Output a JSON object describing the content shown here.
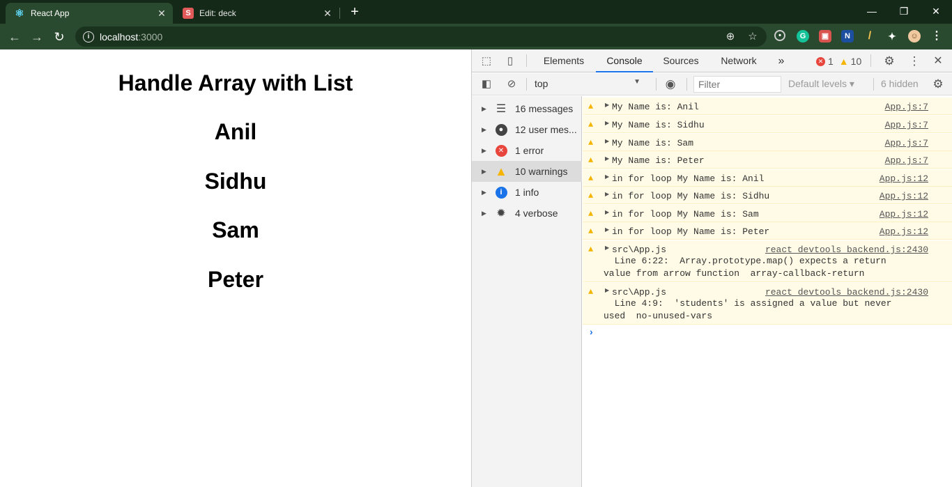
{
  "tabs": [
    {
      "title": "React App",
      "active": true,
      "favicon": "react-icon"
    },
    {
      "title": "Edit: deck",
      "active": false,
      "favicon": "s-icon"
    }
  ],
  "toolbar": {
    "url_host": "localhost",
    "url_port": ":3000"
  },
  "page": {
    "heading": "Handle Array with List",
    "names": [
      "Anil",
      "Sidhu",
      "Sam",
      "Peter"
    ]
  },
  "devtools": {
    "tabs": [
      "Elements",
      "Console",
      "Sources",
      "Network"
    ],
    "more": "»",
    "error_count": "1",
    "warning_count": "10",
    "context": "top",
    "filter_placeholder": "Filter",
    "levels": "Default levels ▾",
    "hidden": "6 hidden",
    "sidebar": [
      {
        "label": "16 messages",
        "icon": "list-icon"
      },
      {
        "label": "12 user mes...",
        "icon": "user-icon"
      },
      {
        "label": "1 error",
        "icon": "error-icon"
      },
      {
        "label": "10 warnings",
        "icon": "warning-icon",
        "selected": true
      },
      {
        "label": "1 info",
        "icon": "info-icon"
      },
      {
        "label": "4 verbose",
        "icon": "bug-icon"
      }
    ],
    "messages": [
      {
        "text": "My Name is: Anil",
        "source": "App.js:7"
      },
      {
        "text": "My Name is: Sidhu",
        "source": "App.js:7"
      },
      {
        "text": "My Name is: Sam",
        "source": "App.js:7"
      },
      {
        "text": "My Name is: Peter",
        "source": "App.js:7"
      },
      {
        "text": "in for loop My Name is: Anil",
        "source": "App.js:12"
      },
      {
        "text": "in for loop My Name is: Sidhu",
        "source": "App.js:12"
      },
      {
        "text": "in for loop My Name is: Sam",
        "source": "App.js:12"
      },
      {
        "text": "in for loop My Name is: Peter",
        "source": "App.js:12"
      }
    ],
    "lint_messages": [
      {
        "text": "src\\App.js",
        "source": "react_devtools_backend.js:2430",
        "line1": "  Line 6:22:  Array.prototype.map() expects a return",
        "line2": "value from arrow function  array-callback-return"
      },
      {
        "text": "src\\App.js",
        "source": "react_devtools_backend.js:2430",
        "line1": "  Line 4:9:  'students' is assigned a value but never",
        "line2": "used  no-unused-vars"
      }
    ],
    "prompt": "›"
  },
  "colors": {
    "browser_frame": "#142918",
    "toolbar": "#2a4a2f",
    "warning_bg": "#fffbe6",
    "accent": "#1a73e8"
  }
}
